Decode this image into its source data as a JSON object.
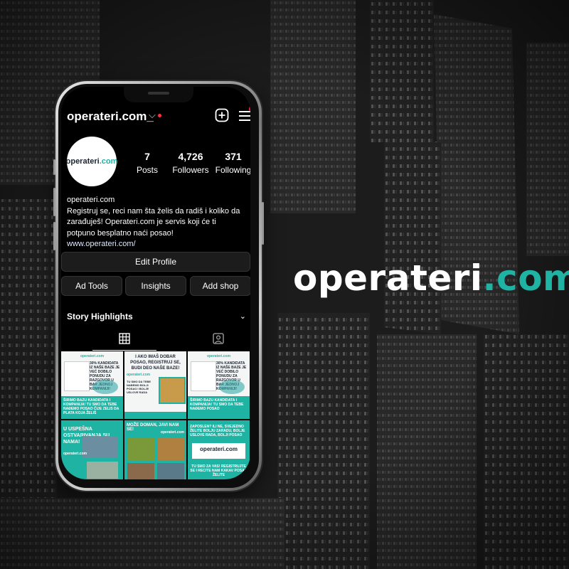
{
  "brand": {
    "word": "operateri",
    "accent": ".com",
    "colors": {
      "white": "#ffffff",
      "teal": "#1fb3a3"
    }
  },
  "profile": {
    "username": "operateri.com_",
    "avatar_logo": {
      "word": "operateri",
      "accent": ".com"
    },
    "stats": [
      {
        "count": "7",
        "label": "Posts"
      },
      {
        "count": "4,726",
        "label": "Followers"
      },
      {
        "count": "371",
        "label": "Following"
      }
    ],
    "display_name": "operateri.com",
    "bio": "Registruj se, reci nam šta želis da radiš i koliko da zarađuješ! Operateri.com je servis koji će ti potpuno besplatno naći posao!",
    "website": "www.operateri.com/"
  },
  "buttons": {
    "edit_profile": "Edit Profile",
    "ad_tools": "Ad Tools",
    "insights": "Insights",
    "add_shop": "Add shop"
  },
  "story_highlights": "Story Highlights",
  "icons": {
    "dropdown": "chevron-down-icon",
    "create": "plus-square-icon",
    "menu": "hamburger-menu-icon",
    "grid": "grid-icon",
    "tagged": "tagged-person-icon"
  },
  "posts": [
    {
      "headline": "30% KANDIDATA IZ NAŠE BAZE JE VEĆ DOBILO PONUDU ZA RAZGOVOR U BAR JEDNOJ KOMPANIJI!",
      "logo": "operateri.com",
      "footer": "ŠIRIMO BAZU KANDIDATA I KOMPANIJA! TU SMO DA TEBE NAĐEMO POSAO ČIJE ZELIS DA PLATA KOJA ŽELIŠ"
    },
    {
      "headline": "I AKO IMAŠ DOBAR POSAO, REGISTRUJ SE, BUDI DEO NAŠE BAZE!",
      "logo": "operateri.com",
      "footer": "TU SMO DA TEBE NAĐEMO BOLJI POSAO I BOLJE USLOVE RADA"
    },
    {
      "headline": "30% KANDIDATA IZ NAŠE BAZE JE VEĆ DOBILO PONUDU ZA RAZGOVOR U BAR JEDNOJ KOMPANIJI!",
      "logo": "operateri.com",
      "footer": "ŠIRIMO BAZU KANDIDATA I KOMPANIJA! TU SMO DA TEBE NAĐEMO POSAO"
    },
    {
      "headline": "U USPEŠNA OSTVARIVANJA SU NAMA!",
      "logo": "operateri.com",
      "footer": ""
    },
    {
      "headline": "MOŽE DOMAN, JAVI NAM SE!",
      "logo": "operateri.com",
      "footer": ""
    },
    {
      "headline": "ZAPOSLEN? ILI NE, SVEJEDNO ŽELITE BOLJU ZARADU, BOLJE USLOVE RADA, BOLJI POSAO",
      "logo": "operateri.com",
      "footer": "TU SMO ZA VAS! REGISTRUJTE SE I RECITE NAM KAKAV POSAO ŽELITE"
    }
  ]
}
